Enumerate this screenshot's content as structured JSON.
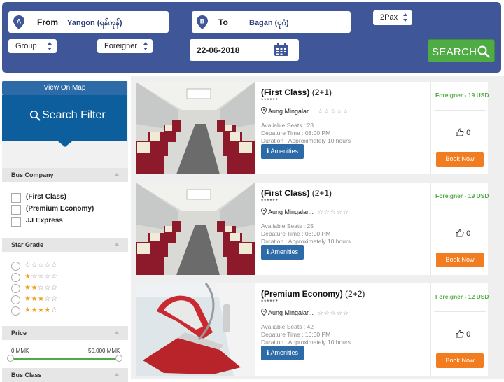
{
  "search": {
    "from_marker": "A",
    "from_label": "From",
    "from_value": "Yangon (ရန်ကုန်)",
    "to_marker": "B",
    "to_label": "To",
    "to_value": "Bagan (ပုဂံ)",
    "pax": "2Pax",
    "group": "Group",
    "nationality": "Foreigner",
    "date": "22-06-2018",
    "search_button": "SEARCH"
  },
  "sidebar": {
    "view_map": "View On Map",
    "filter_title": "Search Filter",
    "bus_company": {
      "title": "Bus Company",
      "options": [
        "(First Class)",
        "(Premium Economy)",
        "JJ Express"
      ]
    },
    "star_grade": {
      "title": "Star Grade",
      "options": [
        {
          "stars": 0,
          "text": "☆☆☆☆☆"
        },
        {
          "stars": 1,
          "text": "☆☆☆☆☆"
        },
        {
          "stars": 2,
          "text": "☆☆☆☆☆"
        },
        {
          "stars": 3,
          "text": "☆☆☆☆☆"
        },
        {
          "stars": 4,
          "text": "☆☆☆☆☆"
        }
      ]
    },
    "price": {
      "title": "Price",
      "min": "0 MMK",
      "max": "50,000 MMK"
    },
    "bus_class": {
      "title": "Bus Class"
    }
  },
  "results": [
    {
      "name": "(First Class)",
      "seat_layout": "(2+1)",
      "rating_dots": "******",
      "location": "Aung Mingalar...",
      "stars": "☆☆☆☆☆",
      "available_seats": "Avaliable Seats : 23",
      "departure": "Depature Time : 08:00 PM",
      "duration": "Duration : Approximately 10 hours",
      "amenities": "Amenities",
      "price": "Foreigner - 19 USD",
      "likes": "0",
      "book": "Book Now"
    },
    {
      "name": "(First Class)",
      "seat_layout": "(2+1)",
      "rating_dots": "******",
      "location": "Aung Mingalar...",
      "stars": "☆☆☆☆☆",
      "available_seats": "Avaliable Seats : 25",
      "departure": "Depature Time : 08:00 PM",
      "duration": "Duration : Approximately 10 hours",
      "amenities": "Amenities",
      "price": "Foreigner - 19 USD",
      "likes": "0",
      "book": "Book Now"
    },
    {
      "name": "(Premium Economy)",
      "seat_layout": "(2+2)",
      "rating_dots": "******",
      "location": "Aung Mingalar...",
      "stars": "☆☆☆☆☆",
      "available_seats": "Avaliable Seats : 42",
      "departure": "Depature Time : 10:00 PM",
      "duration": "Duration : Approximately 10 hours",
      "amenities": "Amenities",
      "price": "Foreigner - 12 USD",
      "likes": "0",
      "book": "Book Now"
    }
  ],
  "colors": {
    "header_bg": "#3f5699",
    "search_green": "#4fab44",
    "filter_blue": "#0d5e9c",
    "button_blue": "#2d6aa8",
    "book_orange": "#f27d21",
    "star_gold": "#f0a01e"
  },
  "icons": {
    "from": "map-pin-icon",
    "to": "map-pin-icon",
    "date": "calendar-icon",
    "search": "magnifier-icon",
    "amenities": "info-icon",
    "likes": "thumbs-up-icon",
    "location": "map-pin-icon"
  }
}
